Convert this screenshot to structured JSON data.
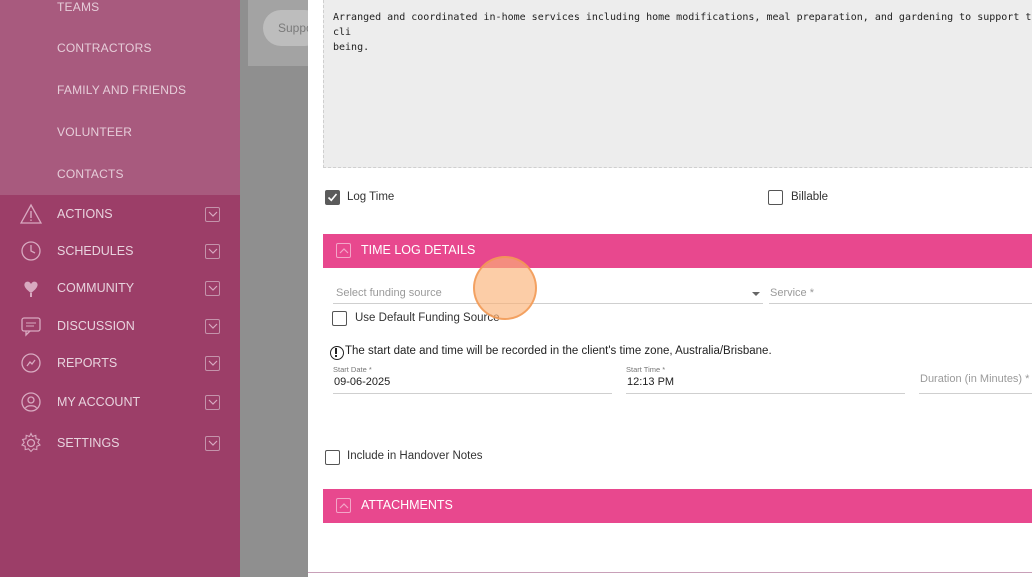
{
  "sidebar": {
    "sub_items": [
      "TEAMS",
      "CONTRACTORS",
      "FAMILY AND FRIENDS",
      "VOLUNTEER",
      "CONTACTS"
    ],
    "nav": [
      {
        "label": "ACTIONS",
        "icon": "warning-icon"
      },
      {
        "label": "SCHEDULES",
        "icon": "clock-icon"
      },
      {
        "label": "COMMUNITY",
        "icon": "heart-hands-icon"
      },
      {
        "label": "DISCUSSION",
        "icon": "chat-icon"
      },
      {
        "label": "REPORTS",
        "icon": "report-icon"
      },
      {
        "label": "MY ACCOUNT",
        "icon": "user-icon"
      },
      {
        "label": "SETTINGS",
        "icon": "gear-icon"
      }
    ]
  },
  "background": {
    "pill_text": "Suppo"
  },
  "modal": {
    "notes_text": "Arranged and coordinated in-home services including home modifications, meal preparation, and gardening to support the cli\nbeing.",
    "log_time_label": "Log Time",
    "log_time_checked": true,
    "billable_label": "Billable",
    "billable_checked": false,
    "time_log_section": {
      "title": "TIME LOG DETAILS",
      "funding_placeholder": "Select funding source",
      "service_placeholder": "Service *",
      "default_funding_label": "Use Default Funding Source",
      "timezone_info": "The start date and time will be recorded in the client's time zone, Australia/Brisbane.",
      "start_date_label": "Start Date *",
      "start_date_value": "09-06-2025",
      "start_time_label": "Start Time *",
      "start_time_value": "12:13 PM",
      "duration_placeholder": "Duration (in Minutes) *"
    },
    "handover_label": "Include in Handover Notes",
    "attachments_title": "ATTACHMENTS"
  },
  "colors": {
    "sidebar": "#9c3e68",
    "sidebar_sub": "#a85a7e",
    "section_bar": "#e8488e"
  }
}
